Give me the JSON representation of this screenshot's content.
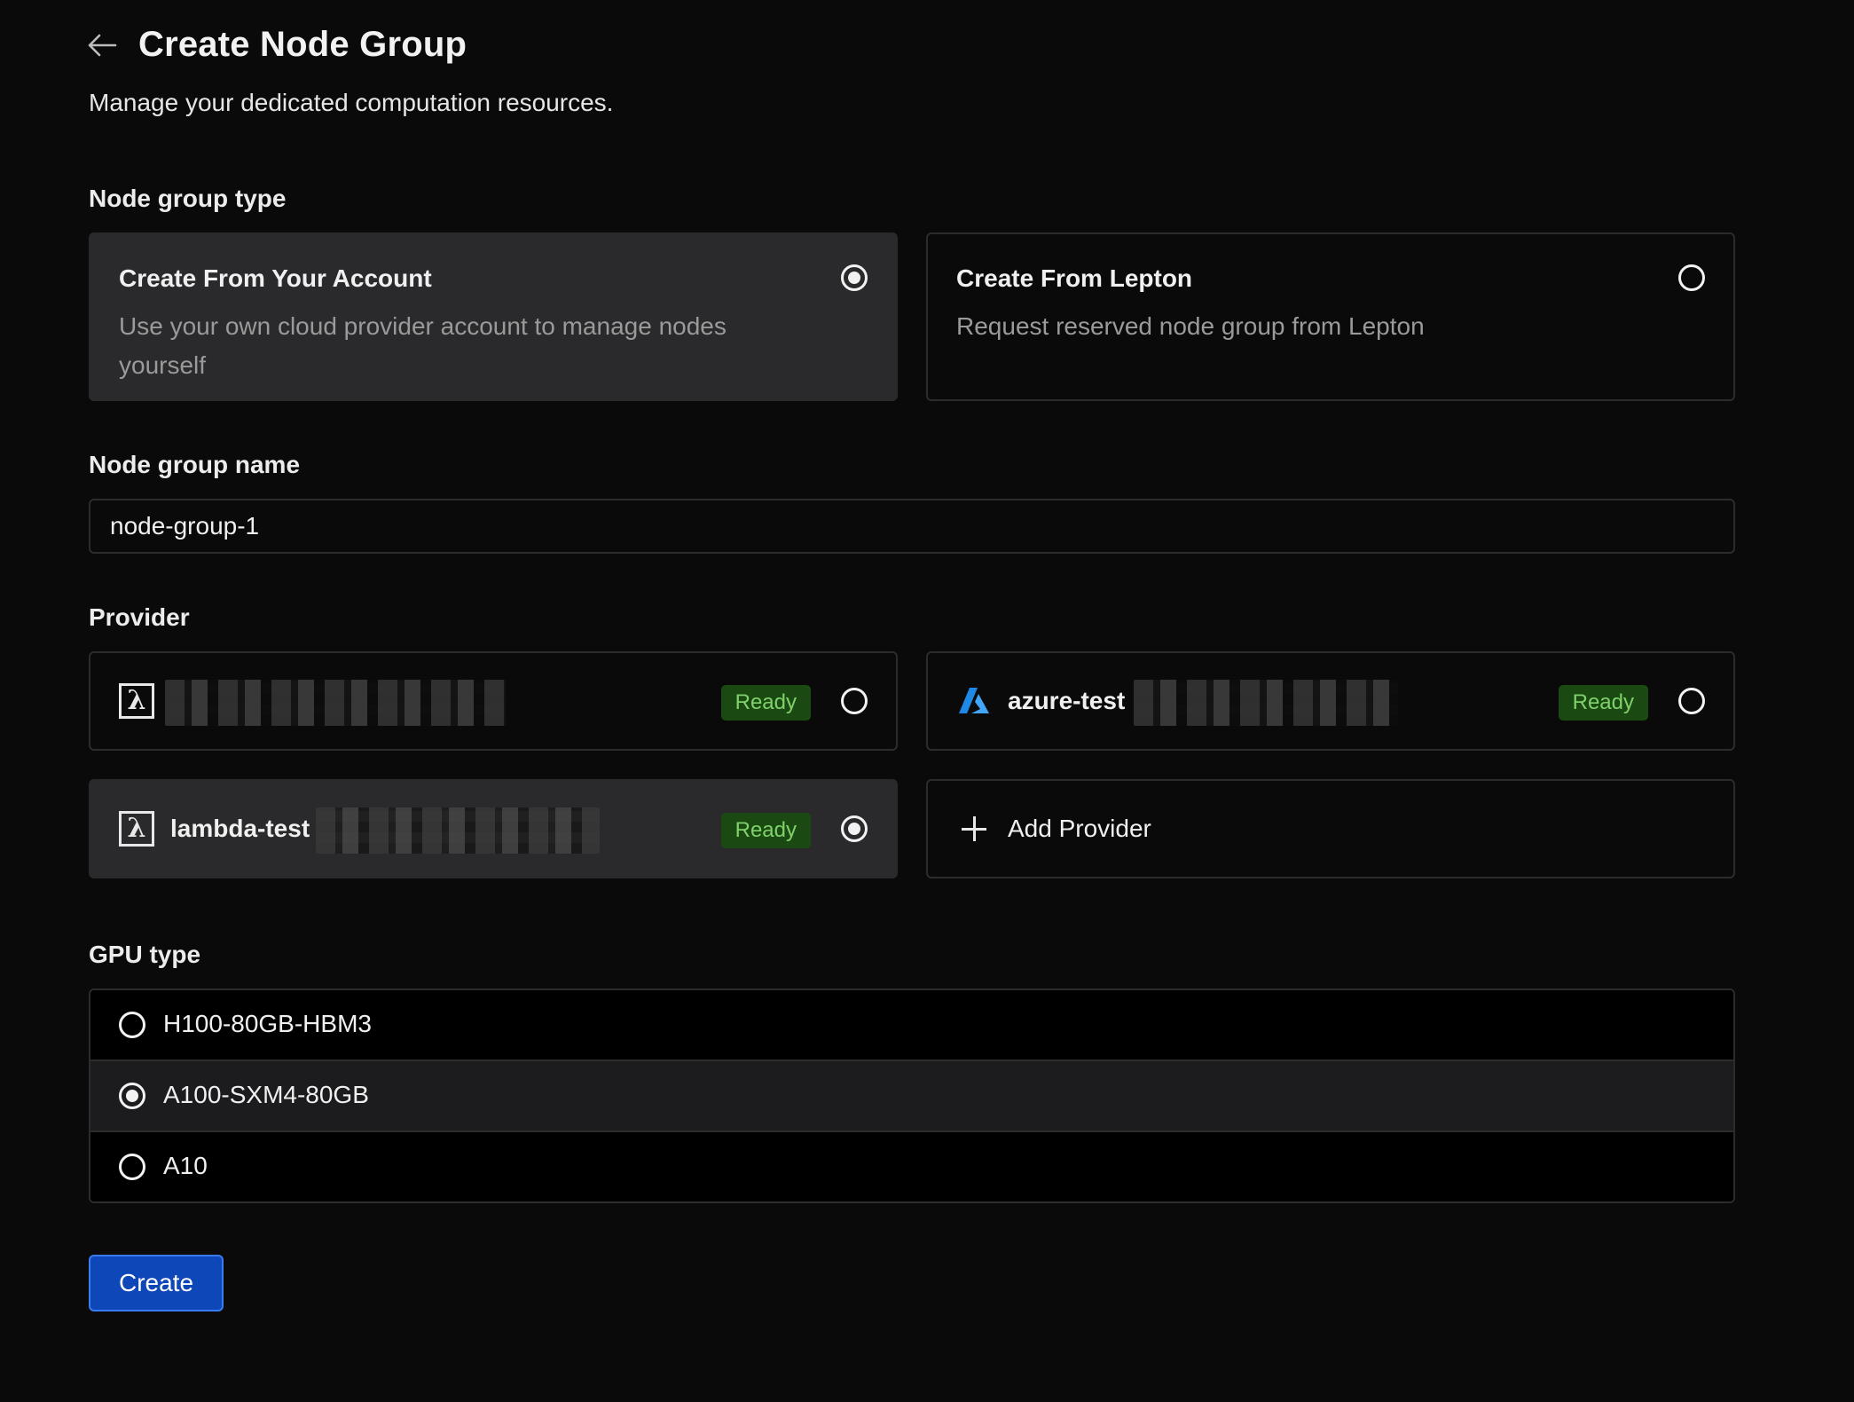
{
  "header": {
    "title": "Create Node Group",
    "subtitle": "Manage your dedicated computation resources."
  },
  "node_group_type": {
    "label": "Node group type",
    "options": [
      {
        "title": "Create From Your Account",
        "description": "Use your own cloud provider account to manage nodes yourself",
        "selected": true
      },
      {
        "title": "Create From Lepton",
        "description": "Request reserved node group from Lepton",
        "selected": false
      }
    ]
  },
  "node_group_name": {
    "label": "Node group name",
    "value": "node-group-1"
  },
  "provider": {
    "label": "Provider",
    "items": [
      {
        "icon": "lambda-icon",
        "name": "",
        "status": "Ready",
        "selected": false
      },
      {
        "icon": "azure-icon",
        "name": "azure-test",
        "status": "Ready",
        "selected": false
      },
      {
        "icon": "lambda-icon",
        "name": "lambda-test",
        "status": "Ready",
        "selected": true
      }
    ],
    "add_label": "Add Provider"
  },
  "gpu_type": {
    "label": "GPU type",
    "options": [
      {
        "label": "H100-80GB-HBM3",
        "selected": false
      },
      {
        "label": "A100-SXM4-80GB",
        "selected": true
      },
      {
        "label": "A10",
        "selected": false
      }
    ]
  },
  "actions": {
    "create_label": "Create"
  },
  "colors": {
    "background": "#0a0a0a",
    "card_selected": "#2a2a2c",
    "badge_bg": "#1a4a12",
    "badge_text": "#7fd16b",
    "primary_button": "#0d47b8",
    "azure_blue": "#1e88e5"
  }
}
